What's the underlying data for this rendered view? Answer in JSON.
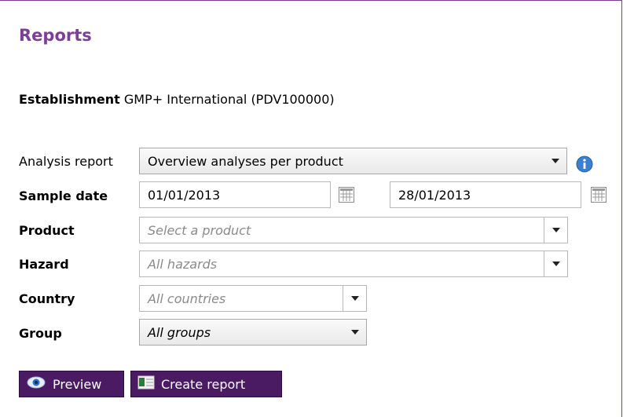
{
  "page": {
    "title": "Reports"
  },
  "establishment": {
    "label": "Establishment",
    "value": "GMP+ International (PDV100000)"
  },
  "form": {
    "analysis_report": {
      "label": "Analysis report",
      "value": "Overview analyses per product"
    },
    "sample_date": {
      "label": "Sample date",
      "from": "01/01/2013",
      "to": "28/01/2013"
    },
    "product": {
      "label": "Product",
      "placeholder": "Select a product"
    },
    "hazard": {
      "label": "Hazard",
      "placeholder": "All hazards"
    },
    "country": {
      "label": "Country",
      "placeholder": "All countries"
    },
    "group": {
      "label": "Group",
      "value": "All groups"
    }
  },
  "actions": {
    "preview_label": "Preview",
    "create_label": "Create report"
  },
  "colors": {
    "accent": "#7b3f97",
    "button": "#4a1a63",
    "info": "#3a7fd0"
  },
  "icons": [
    "info-icon",
    "calendar-icon",
    "dropdown-arrow-icon",
    "eye-icon",
    "spreadsheet-icon"
  ]
}
